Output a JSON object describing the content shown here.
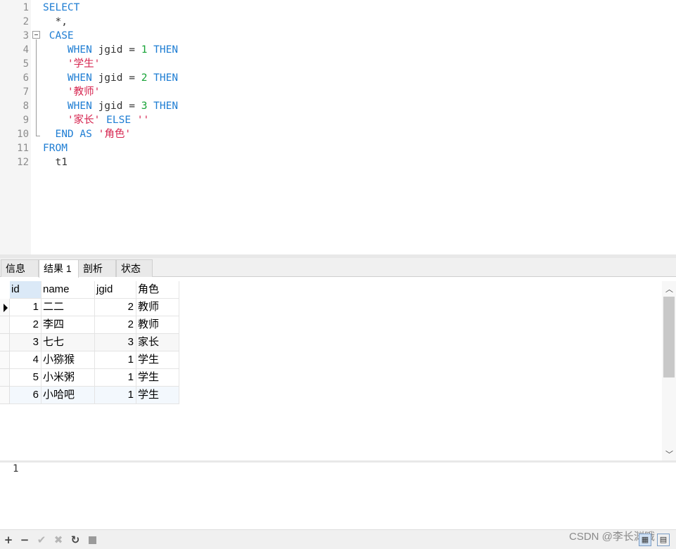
{
  "editor": {
    "line_numbers": [
      "1",
      "2",
      "3",
      "4",
      "5",
      "6",
      "7",
      "8",
      "9",
      "10",
      "11",
      "12"
    ],
    "lines": [
      [
        {
          "t": "SELECT",
          "c": "kw"
        }
      ],
      [
        {
          "t": "  *,",
          "c": ""
        }
      ],
      [
        {
          "t": " CASE",
          "c": "kw"
        }
      ],
      [
        {
          "t": "    ",
          "c": ""
        },
        {
          "t": "WHEN",
          "c": "kw"
        },
        {
          "t": " jgid = ",
          "c": ""
        },
        {
          "t": "1",
          "c": "num"
        },
        {
          "t": " ",
          "c": ""
        },
        {
          "t": "THEN",
          "c": "kw"
        }
      ],
      [
        {
          "t": "    ",
          "c": ""
        },
        {
          "t": "'学生'",
          "c": "str"
        }
      ],
      [
        {
          "t": "    ",
          "c": ""
        },
        {
          "t": "WHEN",
          "c": "kw"
        },
        {
          "t": " jgid = ",
          "c": ""
        },
        {
          "t": "2",
          "c": "num"
        },
        {
          "t": " ",
          "c": ""
        },
        {
          "t": "THEN",
          "c": "kw"
        }
      ],
      [
        {
          "t": "    ",
          "c": ""
        },
        {
          "t": "'教师'",
          "c": "str"
        }
      ],
      [
        {
          "t": "    ",
          "c": ""
        },
        {
          "t": "WHEN",
          "c": "kw"
        },
        {
          "t": " jgid = ",
          "c": ""
        },
        {
          "t": "3",
          "c": "num"
        },
        {
          "t": " ",
          "c": ""
        },
        {
          "t": "THEN",
          "c": "kw"
        }
      ],
      [
        {
          "t": "    ",
          "c": ""
        },
        {
          "t": "'家长'",
          "c": "str"
        },
        {
          "t": " ",
          "c": ""
        },
        {
          "t": "ELSE",
          "c": "kw"
        },
        {
          "t": " ",
          "c": ""
        },
        {
          "t": "''",
          "c": "str"
        }
      ],
      [
        {
          "t": "  ",
          "c": ""
        },
        {
          "t": "END AS",
          "c": "kw"
        },
        {
          "t": " ",
          "c": ""
        },
        {
          "t": "'角色'",
          "c": "str"
        }
      ],
      [
        {
          "t": "FROM",
          "c": "kw"
        }
      ],
      [
        {
          "t": "  t1",
          "c": ""
        }
      ]
    ]
  },
  "tabs": [
    {
      "label": "信息"
    },
    {
      "label": "结果 1"
    },
    {
      "label": "剖析"
    },
    {
      "label": "状态"
    }
  ],
  "grid": {
    "columns": [
      "id",
      "name",
      "jgid",
      "角色"
    ],
    "rows": [
      [
        "1",
        "二二",
        "2",
        "教师"
      ],
      [
        "2",
        "李四",
        "2",
        "教师"
      ],
      [
        "3",
        "七七",
        "3",
        "家长"
      ],
      [
        "4",
        "小猕猴",
        "1",
        "学生"
      ],
      [
        "5",
        "小米粥",
        "1",
        "学生"
      ],
      [
        "6",
        "小哈吧",
        "1",
        "学生"
      ]
    ]
  },
  "output": {
    "text": "1"
  },
  "toolbar": {
    "add": "+",
    "remove": "−",
    "apply": "✔",
    "discard": "✖",
    "refresh": "↻",
    "grid_view": "▦",
    "form_view": "▤"
  },
  "watermark": "CSDN @李长渊哦",
  "colors": {
    "keyword": "#1e7dd3",
    "number": "#17a336",
    "string": "#d6244f",
    "selected_header": "#dbe9f7"
  }
}
